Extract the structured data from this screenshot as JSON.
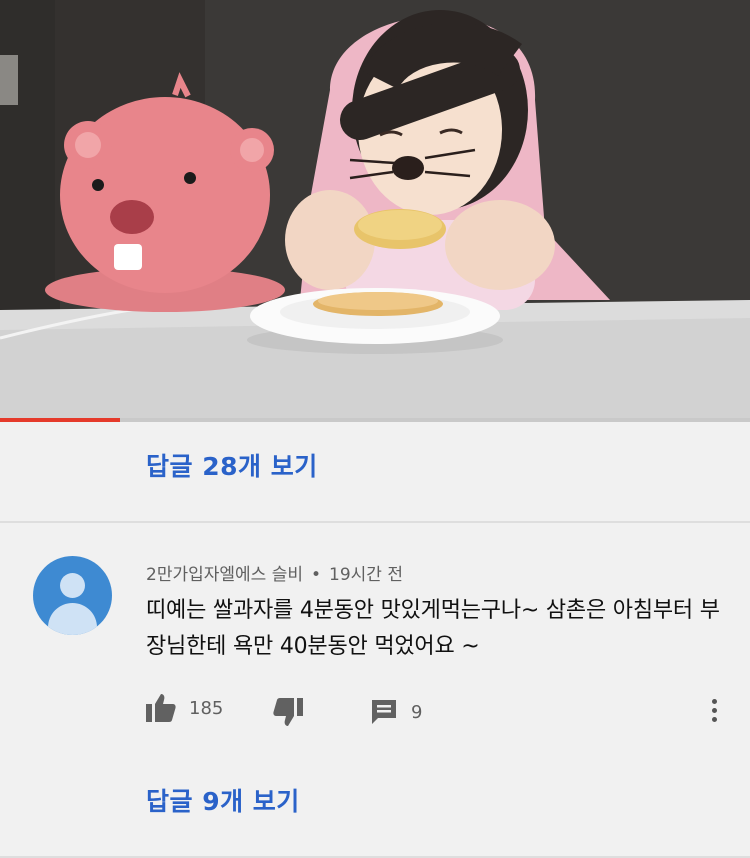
{
  "video": {
    "progress_fraction": 0.16
  },
  "top_replies": {
    "label": "답글 28개 보기"
  },
  "comment": {
    "author": "2만가입자엘에스 슬비",
    "separator": "•",
    "time": "19시간 전",
    "text": "띠예는 쌀과자를 4분동안 맛있게먹는구나~ 삼촌은 아침부터 부장님한테 욕만 40분동안 먹었어요 ~",
    "likes": "185",
    "replies_count": "9"
  },
  "bottom_replies": {
    "label": "답글 9개 보기"
  },
  "icons": [
    "thumbs-up-icon",
    "thumbs-down-icon",
    "comment-icon",
    "more-vert-icon"
  ],
  "colors": {
    "link": "#2a62c9",
    "progress": "#e53a2b",
    "avatar": "#3e8ad2"
  }
}
